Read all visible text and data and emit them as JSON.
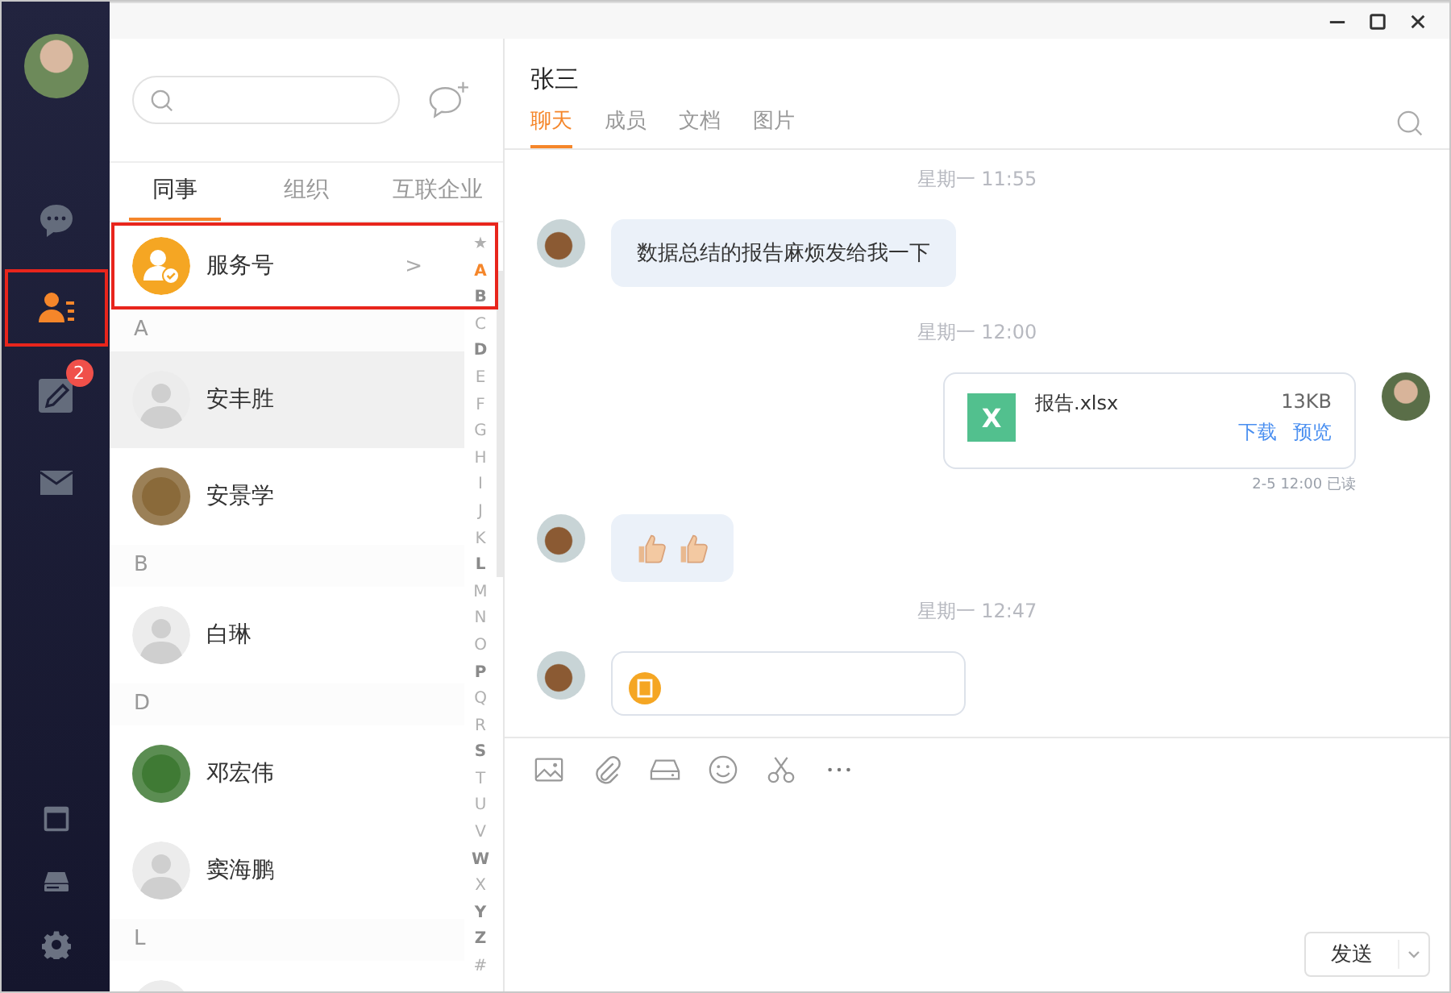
{
  "nav": {
    "top": [
      {
        "selected": false
      },
      {
        "selected": true,
        "highlighted": true
      },
      {
        "selected": false,
        "badge": "2"
      },
      {
        "selected": false
      }
    ]
  },
  "contacts": {
    "tabs": [
      {
        "label": "同事",
        "selected": true
      },
      {
        "label": "组织",
        "selected": false
      },
      {
        "label": "互联企业",
        "selected": false
      }
    ],
    "items": [
      {
        "kind": "service",
        "name": "服务号",
        "selected": false,
        "highlighted": true,
        "chevron": ">"
      },
      {
        "kind": "header",
        "name": "A"
      },
      {
        "kind": "default",
        "name": "安丰胜",
        "selected": true
      },
      {
        "kind": "photo",
        "name": "安景学",
        "selected": false,
        "color": "#8a6a3a"
      },
      {
        "kind": "header",
        "name": "B"
      },
      {
        "kind": "default",
        "name": "白琳",
        "selected": false
      },
      {
        "kind": "header",
        "name": "D"
      },
      {
        "kind": "photo",
        "name": "邓宏伟",
        "selected": false,
        "color": "#3f7a34"
      },
      {
        "kind": "default",
        "name": "窦海鹏",
        "selected": false
      },
      {
        "kind": "header",
        "name": "L"
      },
      {
        "kind": "default",
        "selected": false
      }
    ],
    "index": [
      {
        "label": "★",
        "selected": false,
        "disabled": true
      },
      {
        "label": "A",
        "selected": true,
        "disabled": false
      },
      {
        "label": "B",
        "selected": false,
        "disabled": false
      },
      {
        "label": "C",
        "selected": false,
        "disabled": true
      },
      {
        "label": "D",
        "selected": false,
        "disabled": false
      },
      {
        "label": "E",
        "selected": false,
        "disabled": true
      },
      {
        "label": "F",
        "selected": false,
        "disabled": true
      },
      {
        "label": "G",
        "selected": false,
        "disabled": true
      },
      {
        "label": "H",
        "selected": false,
        "disabled": true
      },
      {
        "label": "I",
        "selected": false,
        "disabled": true
      },
      {
        "label": "J",
        "selected": false,
        "disabled": true
      },
      {
        "label": "K",
        "selected": false,
        "disabled": true
      },
      {
        "label": "L",
        "selected": false,
        "disabled": false
      },
      {
        "label": "M",
        "selected": false,
        "disabled": true
      },
      {
        "label": "N",
        "selected": false,
        "disabled": true
      },
      {
        "label": "O",
        "selected": false,
        "disabled": true
      },
      {
        "label": "P",
        "selected": false,
        "disabled": false
      },
      {
        "label": "Q",
        "selected": false,
        "disabled": true
      },
      {
        "label": "R",
        "selected": false,
        "disabled": true
      },
      {
        "label": "S",
        "selected": false,
        "disabled": false
      },
      {
        "label": "T",
        "selected": false,
        "disabled": true
      },
      {
        "label": "U",
        "selected": false,
        "disabled": true
      },
      {
        "label": "V",
        "selected": false,
        "disabled": true
      },
      {
        "label": "W",
        "selected": false,
        "disabled": false
      },
      {
        "label": "X",
        "selected": false,
        "disabled": true
      },
      {
        "label": "Y",
        "selected": false,
        "disabled": false
      },
      {
        "label": "Z",
        "selected": false,
        "disabled": false
      },
      {
        "label": "#",
        "selected": false,
        "disabled": true
      }
    ]
  },
  "chat": {
    "title": "张三",
    "tabs": [
      {
        "label": "聊天",
        "selected": true
      },
      {
        "label": "成员",
        "selected": false
      },
      {
        "label": "文档",
        "selected": false
      },
      {
        "label": "图片",
        "selected": false
      }
    ],
    "messages": [
      {
        "kind": "time",
        "text": "星期一 11:55"
      },
      {
        "kind": "text",
        "outgoing": false,
        "text": "数据总结的报告麻烦发给我一下"
      },
      {
        "kind": "time",
        "text": "星期一 12:00"
      },
      {
        "kind": "file",
        "outgoing": true,
        "icon_letter": "X",
        "name": "报告.xlsx",
        "size": "13KB",
        "actions": [
          "下载",
          "预览"
        ],
        "meta": "2-5 12:00 已读"
      },
      {
        "kind": "emoji",
        "outgoing": false
      },
      {
        "kind": "time",
        "text": "星期一 12:47"
      },
      {
        "kind": "card",
        "outgoing": false
      }
    ],
    "send": "发送"
  }
}
